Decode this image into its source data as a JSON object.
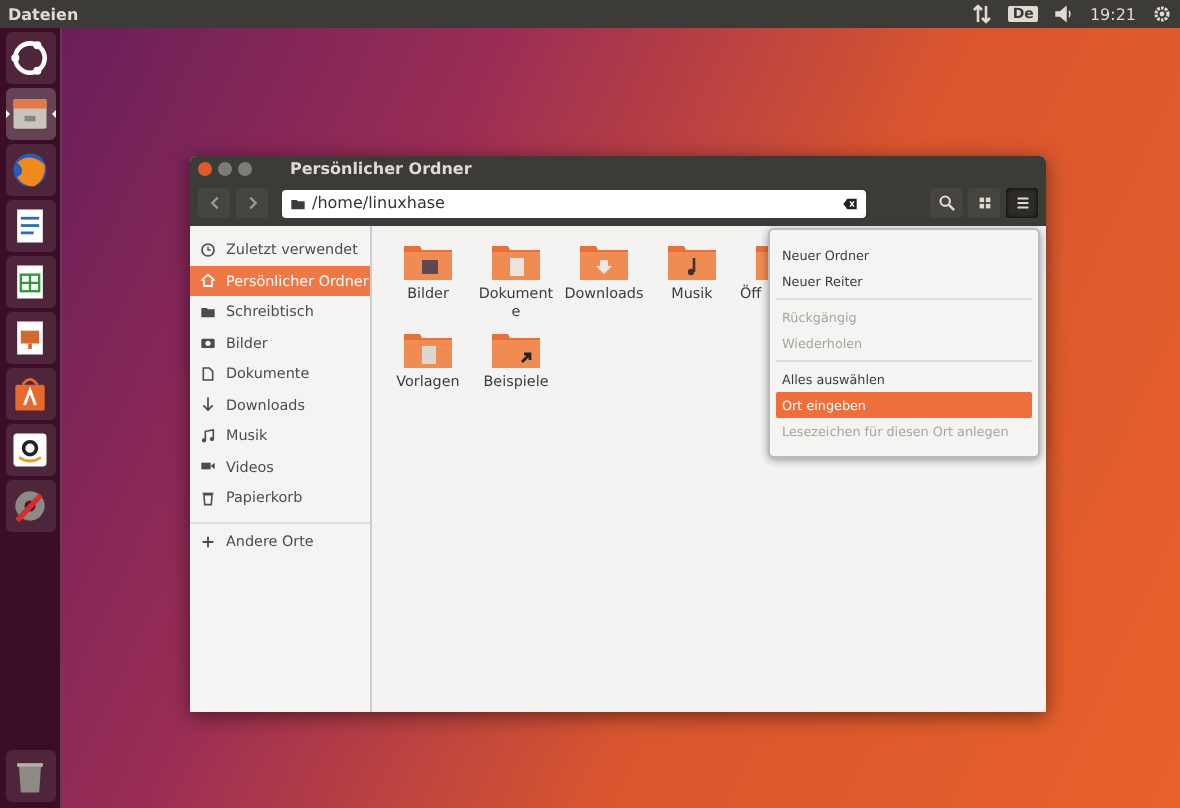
{
  "top_bar": {
    "app_name": "Dateien",
    "keyboard_layout": "De",
    "clock": "19:21"
  },
  "launcher": [
    {
      "kind": "ubuntu",
      "running": false
    },
    {
      "kind": "files",
      "running": true
    },
    {
      "kind": "browser",
      "running": false
    },
    {
      "kind": "writer",
      "running": false
    },
    {
      "kind": "calc",
      "running": false
    },
    {
      "kind": "impress",
      "running": false
    },
    {
      "kind": "store",
      "running": false
    },
    {
      "kind": "shop",
      "running": false
    },
    {
      "kind": "settings",
      "running": false
    },
    {
      "kind": "trash",
      "running": false
    }
  ],
  "window": {
    "title": "Persönlicher Ordner",
    "path": "/home/linuxhase",
    "menu_pressed": true
  },
  "sidebar": {
    "items": [
      {
        "label": "Zuletzt verwendet",
        "selected": false
      },
      {
        "label": "Persönlicher Ordner",
        "selected": true
      },
      {
        "label": "Schreibtisch",
        "selected": false
      },
      {
        "label": "Bilder",
        "selected": false
      },
      {
        "label": "Dokumente",
        "selected": false
      },
      {
        "label": "Downloads",
        "selected": false
      },
      {
        "label": "Musik",
        "selected": false
      },
      {
        "label": "Videos",
        "selected": false
      },
      {
        "label": "Papierkorb",
        "selected": false
      }
    ],
    "other": {
      "label": "Andere Orte",
      "selected": false
    }
  },
  "files": [
    {
      "name": "Bilder",
      "kind": "pictures"
    },
    {
      "name": "Dokumente",
      "kind": "documents"
    },
    {
      "name": "Downloads",
      "kind": "downloads"
    },
    {
      "name": "Musik",
      "kind": "music"
    },
    {
      "name": "Öff",
      "kind": "public"
    },
    {
      "name": "Vorlagen",
      "kind": "templates"
    },
    {
      "name": "Beispiele",
      "kind": "link"
    }
  ],
  "menu": [
    [
      {
        "label": "Neuer Ordner",
        "disabled": false,
        "selected": false
      },
      {
        "label": "Neuer Reiter",
        "disabled": false,
        "selected": false
      }
    ],
    [
      {
        "label": "Rückgängig",
        "disabled": true,
        "selected": false
      },
      {
        "label": "Wiederholen",
        "disabled": true,
        "selected": false
      }
    ],
    [
      {
        "label": "Alles auswählen",
        "disabled": false,
        "selected": false
      },
      {
        "label": "Ort eingeben",
        "disabled": false,
        "selected": true
      },
      {
        "label": "Lesezeichen für diesen Ort anlegen",
        "disabled": true,
        "selected": false
      }
    ]
  ]
}
